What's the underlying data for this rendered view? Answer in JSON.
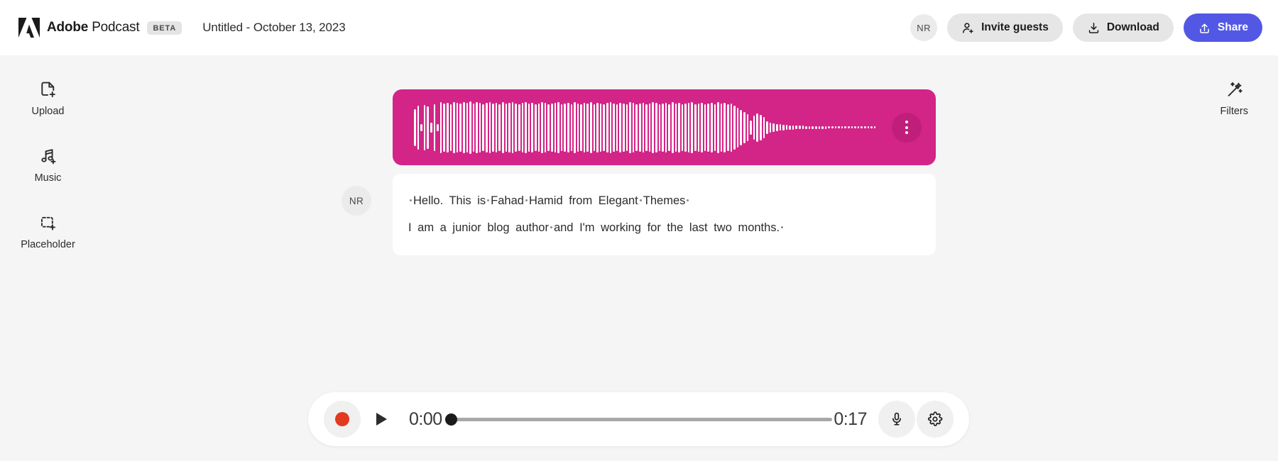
{
  "header": {
    "logo_icon": "adobe-logo",
    "brand_bold": "Adobe",
    "brand_light": " Podcast",
    "beta_label": "BETA",
    "doc_title": "Untitled - October 13, 2023",
    "avatar_initials": "NR",
    "invite_label": "Invite guests",
    "invite_icon": "person-add-icon",
    "download_label": "Download",
    "download_icon": "download-icon",
    "share_label": "Share",
    "share_icon": "upload-icon",
    "share_color": "#5258e4"
  },
  "sidebar": {
    "items": [
      {
        "label": "Upload",
        "icon": "document-add-icon"
      },
      {
        "label": "Music",
        "icon": "music-note-add-icon"
      },
      {
        "label": "Placeholder",
        "icon": "dashed-box-add-icon"
      }
    ]
  },
  "filters": {
    "label": "Filters",
    "icon": "magic-wand-icon"
  },
  "clip": {
    "color": "#d32487",
    "menu_icon": "more-vertical-icon",
    "waveform": [
      52,
      62,
      10,
      64,
      60,
      14,
      66,
      10,
      72,
      68,
      70,
      66,
      72,
      70,
      68,
      72,
      70,
      74,
      68,
      72,
      70,
      66,
      70,
      72,
      68,
      70,
      66,
      72,
      68,
      70,
      72,
      68,
      66,
      70,
      72,
      68,
      70,
      66,
      68,
      72,
      70,
      66,
      68,
      70,
      72,
      66,
      68,
      70,
      66,
      72,
      68,
      66,
      70,
      68,
      72,
      66,
      70,
      68,
      66,
      70,
      72,
      68,
      66,
      70,
      68,
      66,
      72,
      70,
      66,
      68,
      70,
      66,
      68,
      72,
      70,
      66,
      68,
      70,
      66,
      72,
      68,
      70,
      66,
      68,
      70,
      72,
      66,
      68,
      70,
      66,
      68,
      70,
      66,
      72,
      68,
      70,
      66,
      68,
      62,
      56,
      50,
      44,
      38,
      20,
      34,
      40,
      36,
      30,
      18,
      14,
      12,
      10,
      9,
      8,
      7,
      6,
      6,
      5,
      5,
      5,
      4,
      4,
      4,
      4,
      4,
      4,
      4,
      3,
      3,
      3,
      3,
      3,
      3,
      3,
      3,
      3,
      3,
      3,
      3,
      3,
      3,
      3
    ]
  },
  "transcript": {
    "speaker_initials": "NR",
    "line1": [
      {
        "type": "dot"
      },
      {
        "type": "text",
        "value": "Hello.  This  is"
      },
      {
        "type": "dot"
      },
      {
        "type": "text",
        "value": "Fahad"
      },
      {
        "type": "dot"
      },
      {
        "type": "text",
        "value": "Hamid  from  Elegant"
      },
      {
        "type": "dot"
      },
      {
        "type": "text",
        "value": "Themes"
      },
      {
        "type": "dot"
      }
    ],
    "line2": [
      {
        "type": "text",
        "value": "I  am  a  junior  blog  author"
      },
      {
        "type": "dot"
      },
      {
        "type": "text",
        "value": "and  I'm  working  for  the  last  two  months."
      },
      {
        "type": "dot"
      }
    ]
  },
  "player": {
    "record_icon": "record-circle-icon",
    "play_icon": "play-icon",
    "current_time": "0:00",
    "total_time": "0:17",
    "progress_percent": 0,
    "mic_icon": "microphone-icon",
    "settings_icon": "gear-icon"
  }
}
